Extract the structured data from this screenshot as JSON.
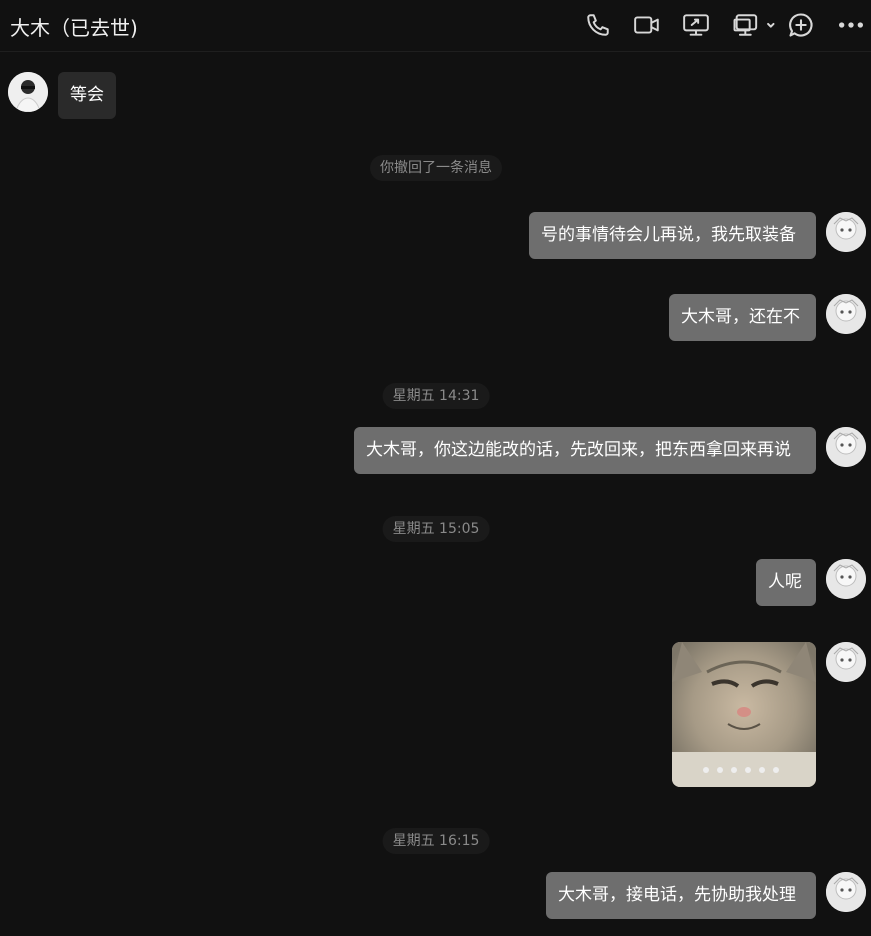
{
  "header": {
    "title": "大木（已去世)",
    "icons": [
      "phone-icon",
      "video-call-icon",
      "screen-share-icon",
      "remote-assist-icon",
      "add-member-icon",
      "more-icon"
    ]
  },
  "messages": [
    {
      "side": "left",
      "type": "text",
      "text": "等会"
    },
    {
      "type": "system",
      "text": "你撤回了一条消息"
    },
    {
      "side": "right",
      "type": "text",
      "text": "号的事情待会儿再说，我先取装备"
    },
    {
      "side": "right",
      "type": "text",
      "text": "大木哥，还在不"
    },
    {
      "type": "time",
      "text": "星期五 14:31"
    },
    {
      "side": "right",
      "type": "text",
      "text": "大木哥，你这边能改的话，先改回来，把东西拿回来再说"
    },
    {
      "type": "time",
      "text": "星期五 15:05"
    },
    {
      "side": "right",
      "type": "text",
      "text": "人呢"
    },
    {
      "side": "right",
      "type": "image",
      "image": "cat-sticker"
    },
    {
      "type": "time",
      "text": "星期五 16:15"
    },
    {
      "side": "right",
      "type": "text",
      "text": "大木哥，接电话，先协助我处理"
    }
  ],
  "colors": {
    "background": "#111111",
    "bubble_right": "#6e6e6e",
    "bubble_left": "#2a2a2a"
  }
}
